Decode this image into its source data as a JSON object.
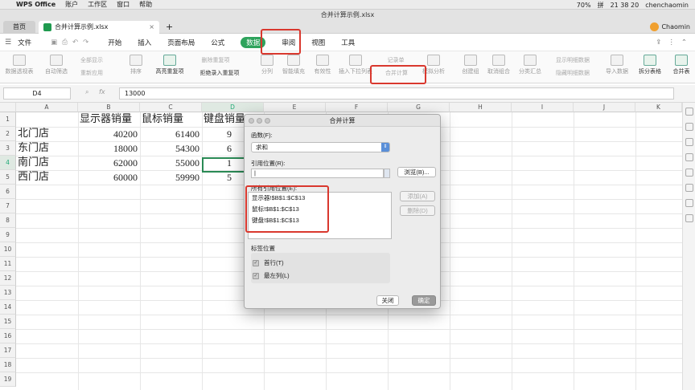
{
  "menubar": {
    "app": "WPS Office",
    "menus": [
      "账户",
      "工作区",
      "窗口",
      "帮助"
    ],
    "battery": "70%",
    "ime": "拼",
    "clock": "21 38 20",
    "user": "chenchaomin"
  },
  "window": {
    "title": "合并计算示例.xlsx",
    "home_tab": "首页",
    "doc_tab": "合并计算示例.xlsx",
    "new_tab": "+",
    "account": "Chaomin"
  },
  "ribbon": {
    "file_menu": "文件",
    "tabs": [
      "开始",
      "插入",
      "页面布局",
      "公式",
      "数据",
      "审阅",
      "视图",
      "工具"
    ],
    "active_tab": "数据"
  },
  "toolbar": {
    "pivot": "数据透视表",
    "auto_filter": "自动筛选",
    "show_all": "全部显示",
    "reapply": "重新应用",
    "sort": "排序",
    "highlight_dup": "高亮重复项",
    "remove_dup": "删除重复项",
    "reject_dup": "拒绝录入重复项",
    "split": "分列",
    "smart_fill": "智能填充",
    "validity": "有效性",
    "dropdown": "插入下拉列表",
    "record": "记录单",
    "consolidate": "合并计算",
    "whatif": "模拟分析",
    "group": "创建组",
    "ungroup": "取消组合",
    "subtotal": "分类汇总",
    "show_detail": "显示明细数据",
    "hide_detail": "隐藏明细数据",
    "import": "导入数据",
    "split_table": "拆分表格",
    "merge_table": "合并表"
  },
  "formula_bar": {
    "cell_ref": "D4",
    "fx": "fx",
    "value": "13000"
  },
  "sheet": {
    "columns": [
      "A",
      "B",
      "C",
      "D",
      "E",
      "F",
      "G",
      "H",
      "I",
      "J",
      "K"
    ],
    "rows": [
      "1",
      "2",
      "3",
      "4",
      "5",
      "6",
      "7",
      "8",
      "9",
      "10",
      "11",
      "12",
      "13",
      "14",
      "15",
      "16",
      "17",
      "18",
      "19"
    ],
    "headers": [
      "显示器销量",
      "鼠标销量",
      "键盘销量"
    ],
    "stores": [
      "北门店",
      "东门店",
      "南门店",
      "西门店"
    ],
    "col_b": [
      "40200",
      "18000",
      "62000",
      "60000"
    ],
    "col_c": [
      "61400",
      "54300",
      "55000",
      "59990"
    ],
    "col_d_partial": [
      "9",
      "6",
      "1",
      "5"
    ]
  },
  "dialog": {
    "title": "合并计算",
    "function_label": "函数(F):",
    "function_value": "求和",
    "ref_label": "引用位置(R):",
    "ref_value": "|",
    "browse": "浏览(B)...",
    "all_refs_label": "所有引用位置(E):",
    "refs": [
      "显示器!$B$1:$C$13",
      "鼠标!$B$1:$C$13",
      "键盘!$B$1:$C$13"
    ],
    "add": "添加(A)",
    "delete": "删除(D)",
    "label_group": "标签位置",
    "top_row": "首行(T)",
    "left_col": "最左列(L)",
    "close": "关闭",
    "ok": "确定"
  },
  "colors": {
    "accent_green": "#2ea35c",
    "highlight_red": "#d9382e"
  }
}
